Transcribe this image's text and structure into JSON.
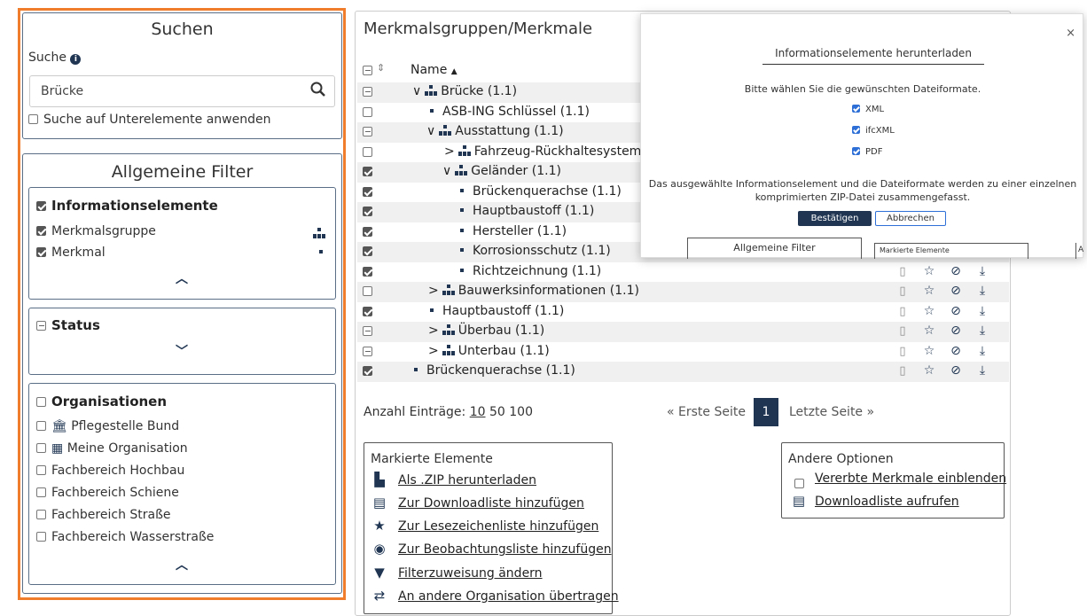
{
  "search": {
    "title": "Suchen",
    "label": "Suche",
    "value": "Brücke",
    "subelements_label": "Suche auf Unterelemente anwenden"
  },
  "filters": {
    "title": "Allgemeine Filter",
    "info": {
      "header": "Informationselemente",
      "items": [
        "Merkmalsgruppe",
        "Merkmal"
      ]
    },
    "status": {
      "header": "Status"
    },
    "orgs": {
      "header": "Organisationen",
      "items": [
        "Pflegestelle Bund",
        "Meine Organisation",
        "Fachbereich Hochbau",
        "Fachbereich Schiene",
        "Fachbereich Straße",
        "Fachbereich Wasserstraße"
      ]
    }
  },
  "main": {
    "title": "Merkmalsgruppen/Merkmale",
    "col_name": "Name",
    "rows": [
      {
        "label": "Brücke (1.1)"
      },
      {
        "label": "ASB-ING Schlüssel (1.1)"
      },
      {
        "label": "Ausstattung (1.1)"
      },
      {
        "label": "Fahrzeug-Rückhaltesystem"
      },
      {
        "label": "Geländer (1.1)"
      },
      {
        "label": "Brückenquerachse (1.1)"
      },
      {
        "label": "Hauptbaustoff (1.1)"
      },
      {
        "label": "Hersteller (1.1)"
      },
      {
        "label": "Korrosionsschutz (1.1)"
      },
      {
        "label": "Richtzeichnung (1.1)"
      },
      {
        "label": "Bauwerksinformationen (1.1)"
      },
      {
        "label": "Hauptbaustoff (1.1)"
      },
      {
        "label": "Überbau (1.1)"
      },
      {
        "label": "Unterbau (1.1)"
      },
      {
        "label": "Brückenquerachse (1.1)"
      }
    ],
    "pager": {
      "count_label": "Anzahl Einträge:",
      "sizes": [
        "10",
        "50",
        "100"
      ],
      "first": "« Erste Seite",
      "current": "1",
      "last": "Letzte Seite »"
    },
    "marked": {
      "title": "Markierte Elemente",
      "actions": [
        "Als .ZIP herunterladen",
        "Zur Downloadliste hinzufügen",
        "Zur Lesezeichenliste hinzufügen",
        "Zur Beobachtungsliste hinzufügen",
        "Filterzuweisung ändern",
        "An andere Organisation übertragen"
      ]
    },
    "other": {
      "title": "Andere Optionen",
      "inherited": "Vererbte Merkmale einblenden",
      "download_list": "Downloadliste aufrufen"
    }
  },
  "modal": {
    "title": "Informationselemente herunterladen",
    "prompt": "Bitte wählen Sie die gewünschten Dateiformate.",
    "formats": [
      "XML",
      "ifcXML",
      "PDF"
    ],
    "note_line1": "Das ausgewählte Informationselement und die Dateiformate werden zu einer einzelnen",
    "note_line2": "komprimierten ZIP-Datei zusammengefasst.",
    "confirm": "Bestätigen",
    "cancel": "Abbrechen",
    "close": "×",
    "bg_filter_label": "Allgemeine Filter",
    "bg_marked_label": "Markierte Elemente",
    "bg_edge_letter": "A"
  }
}
